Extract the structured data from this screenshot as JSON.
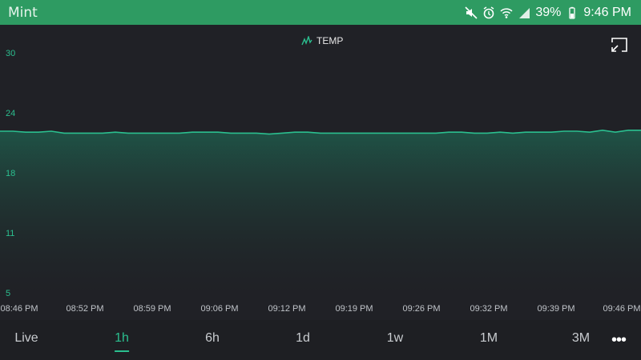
{
  "statusbar": {
    "app_name": "Mint",
    "battery": "39%",
    "time": "9:46 PM"
  },
  "legend": {
    "label": "TEMP"
  },
  "ranges": [
    "Live",
    "1h",
    "6h",
    "1d",
    "1w",
    "1M",
    "3M"
  ],
  "active_range": "1h",
  "colors": {
    "accent": "#2bbf8f",
    "statusbar": "#2e9b62",
    "background": "#202126"
  },
  "chart_data": {
    "type": "area",
    "series": [
      {
        "name": "TEMP",
        "values": [
          22.0,
          22.0,
          21.9,
          21.9,
          22.0,
          21.8,
          21.8,
          21.8,
          21.8,
          21.9,
          21.8,
          21.8,
          21.8,
          21.8,
          21.8,
          21.9,
          21.9,
          21.9,
          21.8,
          21.8,
          21.8,
          21.7,
          21.8,
          21.9,
          21.9,
          21.8,
          21.8,
          21.8,
          21.8,
          21.8,
          21.8,
          21.8,
          21.8,
          21.8,
          21.8,
          21.9,
          21.9,
          21.8,
          21.8,
          21.9,
          21.8,
          21.9,
          21.9,
          21.9,
          22.0,
          22.0,
          21.9,
          22.1,
          21.9,
          22.1,
          22.1
        ]
      }
    ],
    "x_ticks": [
      "08:46 PM",
      "08:52 PM",
      "08:59 PM",
      "09:06 PM",
      "09:12 PM",
      "09:19 PM",
      "09:26 PM",
      "09:32 PM",
      "09:39 PM",
      "09:46 PM"
    ],
    "y_ticks": [
      "30",
      "24",
      "18",
      "11",
      "5"
    ],
    "ylim": [
      5,
      30
    ],
    "grid": false,
    "legend": "top-center"
  }
}
